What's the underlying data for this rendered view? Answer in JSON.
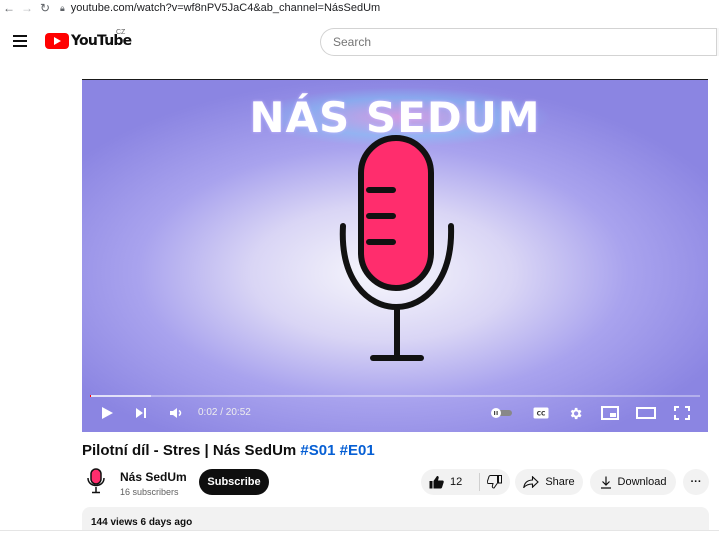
{
  "browser": {
    "url": "youtube.com/watch?v=wf8nPV5JaC4&ab_channel=NásSedUm"
  },
  "header": {
    "logo_text": "YouTube",
    "country_code": "CZ",
    "search_placeholder": "Search"
  },
  "player": {
    "video_overlay_title": "NÁS SEDUM",
    "time_display": "0:02 / 20:52",
    "progress_played_fraction": 0.002,
    "accent_color": "#ff0000"
  },
  "video": {
    "title": "Pilotní díl - Stres | Nás SedUm",
    "hashtags": [
      "#S01",
      "#E01"
    ],
    "channel": {
      "name": "Nás SedUm",
      "subscribers": "16 subscribers"
    },
    "subscribe_label": "Subscribe",
    "like_count": "12",
    "share_label": "Share",
    "download_label": "Download",
    "more_label": "···",
    "stats": "144 views  6 days ago"
  },
  "icons": [
    "back-icon",
    "forward-icon",
    "reload-icon",
    "lock-icon",
    "menu-icon",
    "youtube-logo",
    "play-icon",
    "next-icon",
    "volume-icon",
    "autoplay-toggle-icon",
    "captions-icon",
    "settings-icon",
    "miniplayer-icon",
    "theater-icon",
    "fullscreen-icon",
    "like-icon",
    "dislike-icon",
    "share-icon",
    "download-icon",
    "more-icon",
    "channel-avatar-icon"
  ]
}
